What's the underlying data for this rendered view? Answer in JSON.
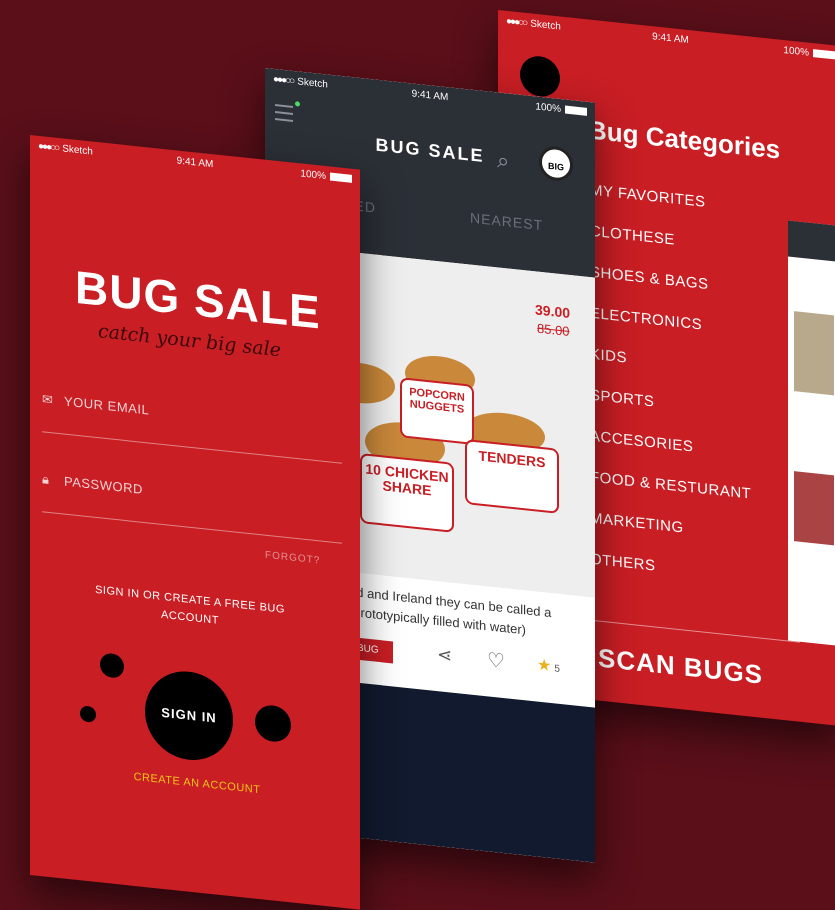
{
  "status": {
    "carrier": "Sketch",
    "time": "9:41 AM",
    "battery": "100%"
  },
  "categories_screen": {
    "title": "Bug Categories",
    "items": [
      "MY FAVORITES",
      "CLOTHESE",
      "SHOES & BAGS",
      "ELECTRONICS",
      "KIDS",
      "SPORTS",
      "ACCESORIES",
      "FOOD & RESTURANT",
      "MARKETING",
      "OTHERS"
    ],
    "scan": "SCAN BUGS"
  },
  "listing_screen": {
    "brand": "BUG SALE",
    "logo": "BIG",
    "tabs": [
      "TED",
      "NEAREST"
    ],
    "price": "39.00",
    "old_price": "85.00",
    "bucket1": "POPCORN NUGGETS",
    "bucket2": "10 CHICKEN SHARE",
    "bucket3": "TENDERS",
    "description": "nd and Ireland they can be called a (prototypically filled with water)",
    "tag": "BUG",
    "rating": "5",
    "icons": {
      "menu": "menu-icon",
      "search": "search-icon",
      "share": "share-icon",
      "heart": "heart-icon",
      "star": "star-icon"
    }
  },
  "signin_screen": {
    "brand": "BUG SALE",
    "tagline": "catch your big sale",
    "email_placeholder": "YOUR EMAIL",
    "password_placeholder": "PASSWORD",
    "forgot": "FORGOT?",
    "invite": "SIGN IN OR CREATE A FREE BUG ACCOUNT",
    "signin": "SIGN IN",
    "create": "CREATE AN ACCOUNT",
    "colors": {
      "red": "#c81e24",
      "yellow": "#f0c419",
      "background": "#5a0f19"
    }
  }
}
